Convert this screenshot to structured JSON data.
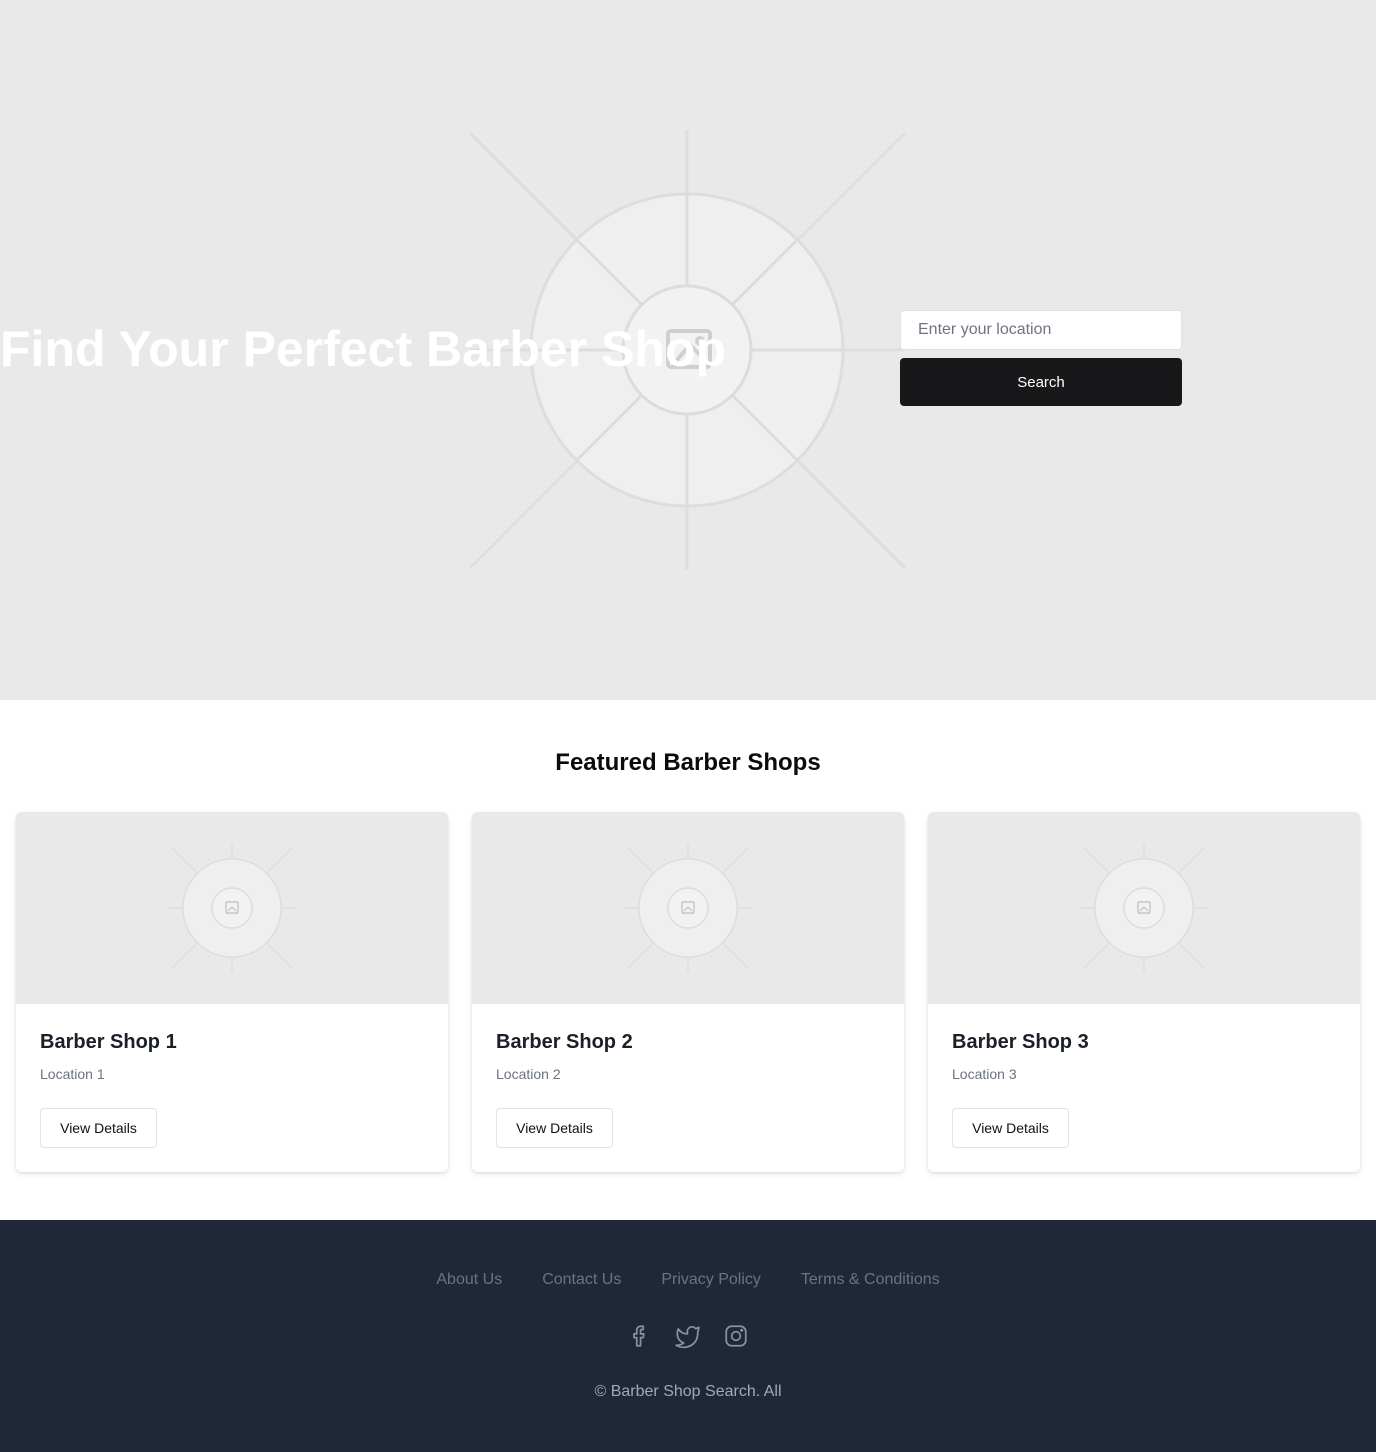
{
  "hero": {
    "title": "Find Your Perfect Barber Shop",
    "background_color": "#e9e9e9",
    "image_icon": "image-placeholder-icon",
    "search": {
      "placeholder": "Enter your location",
      "value": "",
      "button_label": "Search"
    }
  },
  "featured": {
    "title": "Featured Barber Shops",
    "cards": [
      {
        "title": "Barber Shop 1",
        "location": "Location 1",
        "button_label": "View Details"
      },
      {
        "title": "Barber Shop 2",
        "location": "Location 2",
        "button_label": "View Details"
      },
      {
        "title": "Barber Shop 3",
        "location": "Location 3",
        "button_label": "View Details"
      }
    ]
  },
  "footer": {
    "links": [
      "About Us",
      "Contact Us",
      "Privacy Policy",
      "Terms & Conditions"
    ],
    "social_icons": [
      "facebook-icon",
      "twitter-icon",
      "instagram-icon"
    ],
    "copyright": "© Barber Shop Search. All",
    "background_color": "#202837"
  }
}
